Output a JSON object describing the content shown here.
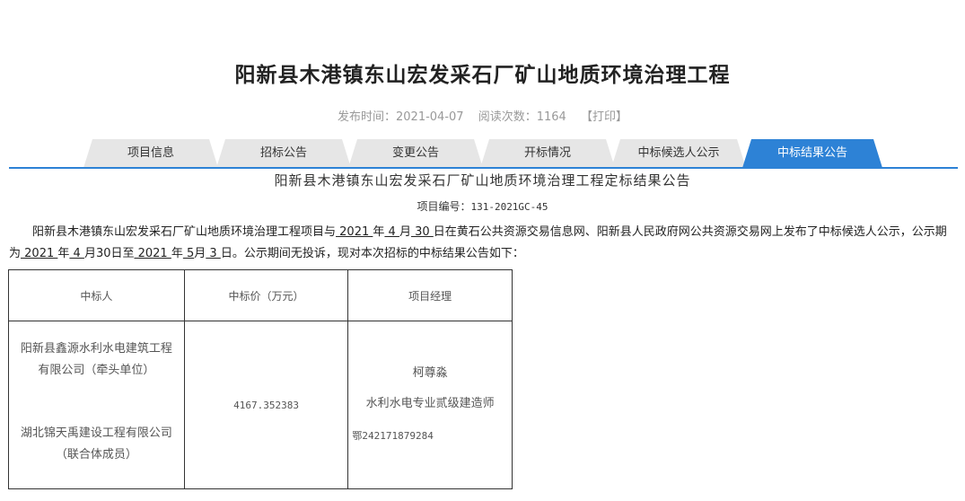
{
  "page": {
    "title": "阳新县木港镇东山宏发采石厂矿山地质环境治理工程",
    "publish_label": "发布时间：",
    "publish_date": "2021-04-07",
    "read_label": "阅读次数：",
    "read_count": "1164",
    "print_label": "【打印】"
  },
  "tabs": [
    {
      "label": "项目信息"
    },
    {
      "label": "招标公告"
    },
    {
      "label": "变更公告"
    },
    {
      "label": "开标情况"
    },
    {
      "label": "中标候选人公示"
    },
    {
      "label": "中标结果公告"
    }
  ],
  "notice": {
    "title": "阳新县木港镇东山宏发采石厂矿山地质环境治理工程定标结果公告",
    "project_no_label": "项目编号：",
    "project_no": "131-2021GC-45",
    "para": {
      "t1": "阳新县木港镇东山宏发采石厂矿山地质环境治理工程项目与",
      "y1": " 2021 ",
      "t2": "年",
      "m1": " 4 ",
      "t3": "月",
      "d1": " 30  ",
      "t4": "日在黄石公共资源交易信息网、阳新县人民政府网公共资源交易网上发布了中标候选人公示，公示期为",
      "y2": " 2021 ",
      "t5": "年",
      "m2": " 4 ",
      "t6": "月30日至",
      "y3": " 2021 ",
      "t7": "年",
      "m3": " 5",
      "t8": "月",
      "d3": " 3  ",
      "t9": "日。公示期间无投诉，现对本次招标的中标结果公告如下："
    }
  },
  "table": {
    "headers": [
      "中标人",
      "中标价（万元）",
      "项目经理"
    ],
    "winner1_line1": "阳新县鑫源水利水电建筑工程",
    "winner1_line2": "有限公司（牵头单位）",
    "winner2_line1": "湖北锦天禹建设工程有限公司",
    "winner2_line2": "（联合体成员）",
    "price": "4167.352383",
    "manager_name": "柯尊淼",
    "manager_title": "水利水电专业贰级建造师",
    "manager_cert": "鄂242171879284"
  }
}
